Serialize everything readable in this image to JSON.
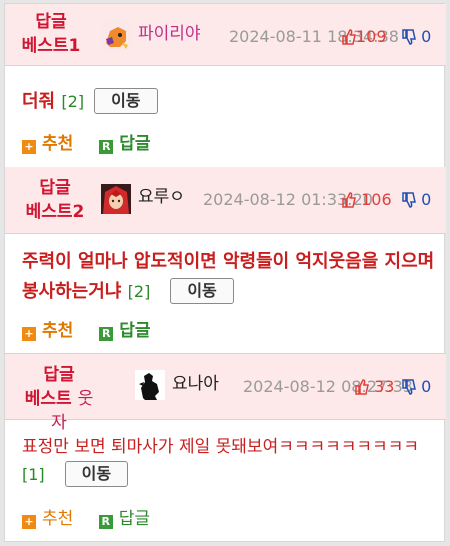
{
  "comments": [
    {
      "badge_line1": "답글",
      "badge_line2": "베스트1",
      "badge_suffix": "",
      "nick": "파이리야",
      "nick_color": "#c0308a",
      "date": "2024-08-11 18:34:38",
      "up_count": "109",
      "down_count": "0",
      "text": "더줘",
      "reply_count": "[2]",
      "move_label": "이동",
      "recommend_label": "추천",
      "reply_label": "답글",
      "recommend_icon": "+",
      "reply_icon": "R",
      "avatar_icon": "charmander-avatar-icon"
    },
    {
      "badge_line1": "답글",
      "badge_line2": "베스트2",
      "badge_suffix": "",
      "nick": "요루ㅇ",
      "nick_color": "#222222",
      "date": "2024-08-12 01:33:20",
      "up_count": "106",
      "down_count": "0",
      "text": "주력이 얼마나 압도적이면 악령들이 억지웃음을 지으며 봉사하는거냐",
      "reply_count": "[2]",
      "move_label": "이동",
      "recommend_label": "추천",
      "reply_label": "답글",
      "recommend_icon": "+",
      "reply_icon": "R",
      "avatar_icon": "red-hair-girl-avatar-icon"
    },
    {
      "badge_line1": "답글",
      "badge_line2": "베스트",
      "badge_suffix": "웃자",
      "nick": "요나아",
      "nick_color": "#222222",
      "date": "2024-08-12 08:27:33",
      "up_count": "33",
      "down_count": "0",
      "text": "표정만 보면 퇴마사가 제일 못돼보여ㅋㅋㅋㅋㅋㅋㅋㅋㅋ",
      "reply_count": "[1]",
      "move_label": "이동",
      "recommend_label": "추천",
      "reply_label": "답글",
      "recommend_icon": "+",
      "reply_icon": "R",
      "avatar_icon": "black-silhouette-avatar-icon"
    }
  ]
}
